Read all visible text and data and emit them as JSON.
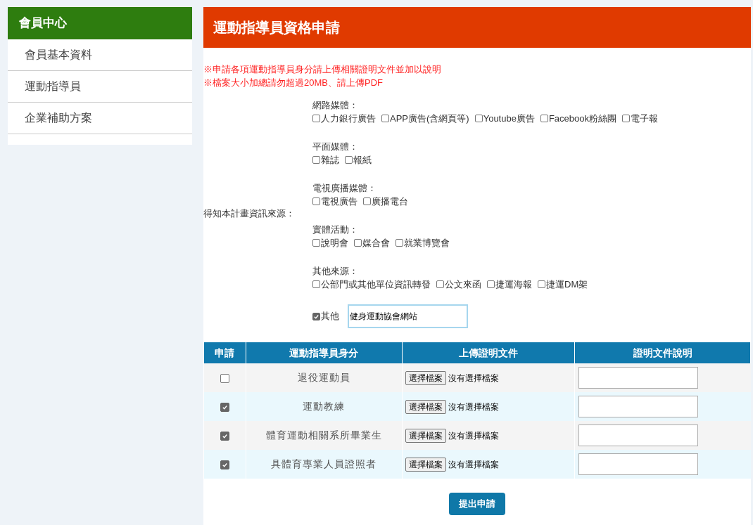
{
  "sidebar": {
    "title": "會員中心",
    "items": [
      {
        "label": "會員基本資料",
        "selected": false
      },
      {
        "label": "運動指導員",
        "selected": false
      },
      {
        "label": "企業補助方案",
        "selected": false
      }
    ]
  },
  "page_title": "運動指導員資格申請",
  "notices": [
    "※申請各項運動指導員身分請上傳相關證明文件並加以說明",
    "※檔案大小加總請勿超過20MB、請上傳PDF"
  ],
  "source": {
    "label": "得知本計畫資訊來源：",
    "groups": [
      {
        "heading": "網路媒體：",
        "options": [
          {
            "label": "人力銀行廣告",
            "checked": false
          },
          {
            "label": "APP廣告(含網頁等)",
            "checked": false
          },
          {
            "label": "Youtube廣告",
            "checked": false
          },
          {
            "label": "Facebook粉絲團",
            "checked": false
          },
          {
            "label": "電子報",
            "checked": false
          }
        ]
      },
      {
        "heading": "平面媒體：",
        "options": [
          {
            "label": "雜誌",
            "checked": false
          },
          {
            "label": "報紙",
            "checked": false
          }
        ]
      },
      {
        "heading": "電視廣播媒體：",
        "options": [
          {
            "label": "電視廣告",
            "checked": false
          },
          {
            "label": "廣播電台",
            "checked": false
          }
        ]
      },
      {
        "heading": "實體活動：",
        "options": [
          {
            "label": "說明會",
            "checked": false
          },
          {
            "label": "媒合會",
            "checked": false
          },
          {
            "label": "就業博覽會",
            "checked": false
          }
        ]
      },
      {
        "heading": "其他來源：",
        "options": [
          {
            "label": "公部門或其他單位資訊轉發",
            "checked": false
          },
          {
            "label": "公文來函",
            "checked": false
          },
          {
            "label": "捷運海報",
            "checked": false
          },
          {
            "label": "捷運DM架",
            "checked": false
          }
        ]
      }
    ],
    "other": {
      "label": "其他",
      "checked": true,
      "value": "健身運動協會網站"
    }
  },
  "table": {
    "columns": [
      "申請",
      "運動指導員身分",
      "上傳證明文件",
      "證明文件說明"
    ],
    "rows": [
      {
        "checked": false,
        "role": "退役運動員",
        "file_button": "選擇檔案",
        "file_status": "沒有選擇檔案"
      },
      {
        "checked": true,
        "role": "運動教練",
        "file_button": "選擇檔案",
        "file_status": "沒有選擇檔案"
      },
      {
        "checked": true,
        "role": "體育運動相關系所畢業生",
        "file_button": "選擇檔案",
        "file_status": "沒有選擇檔案"
      },
      {
        "checked": true,
        "role": "具體育專業人員證照者",
        "file_button": "選擇檔案",
        "file_status": "沒有選擇檔案"
      }
    ]
  },
  "submit": "提出申請"
}
